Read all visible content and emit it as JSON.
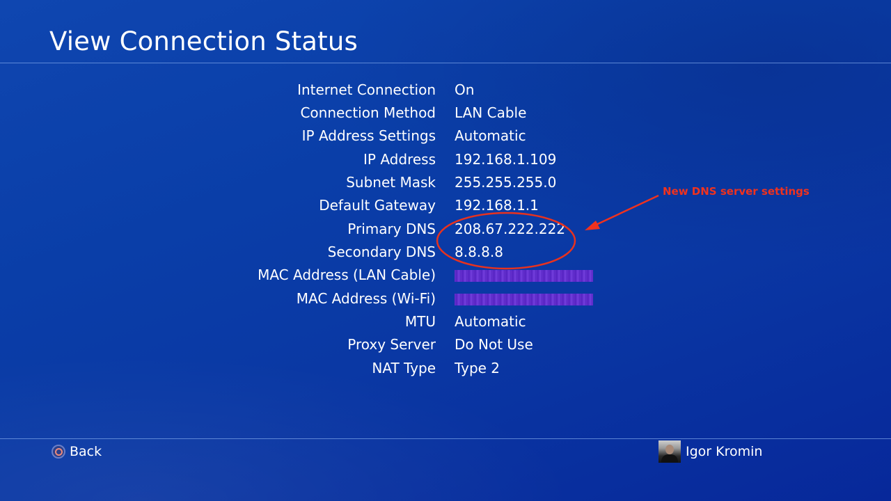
{
  "page": {
    "title": "View Connection Status"
  },
  "status_rows": [
    {
      "label": "Internet Connection",
      "value": "On"
    },
    {
      "label": "Connection Method",
      "value": "LAN Cable"
    },
    {
      "label": "IP Address Settings",
      "value": "Automatic"
    },
    {
      "label": "IP Address",
      "value": "192.168.1.109"
    },
    {
      "label": "Subnet Mask",
      "value": "255.255.255.0"
    },
    {
      "label": "Default Gateway",
      "value": "192.168.1.1"
    },
    {
      "label": "Primary DNS",
      "value": "208.67.222.222"
    },
    {
      "label": "Secondary DNS",
      "value": "8.8.8.8"
    },
    {
      "label": "MAC Address (LAN Cable)",
      "value": "[redacted]"
    },
    {
      "label": "MAC Address (Wi-Fi)",
      "value": "[redacted]"
    },
    {
      "label": "MTU",
      "value": "Automatic"
    },
    {
      "label": "Proxy Server",
      "value": "Do Not Use"
    },
    {
      "label": "NAT Type",
      "value": "Type 2"
    }
  ],
  "annotation": {
    "text": "New DNS server settings",
    "color": "#f0321e"
  },
  "footer": {
    "back_label": "Back",
    "back_icon": "circle-button-icon",
    "user_name": "Igor Kromin"
  },
  "colors": {
    "background": "#0a3ea8",
    "text": "#ffffff",
    "rule": "#7aa0e6",
    "redaction": "#6a2fd0"
  }
}
